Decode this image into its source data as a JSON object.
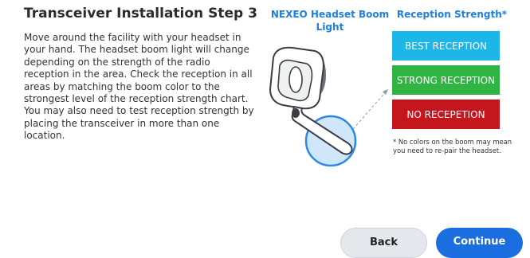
{
  "page": {
    "title": "Transceiver Installation Step 3",
    "instructions": "Move around the facility with your headset in your hand. The headset boom light will change depending on the strength of the radio reception in the area. Check the reception in all areas by matching the boom color to the strongest level of the reception strength chart. You may also need to test reception strength by placing the transceiver in more than one location."
  },
  "boom_light": {
    "heading": "NEXEO Headset Boom Light"
  },
  "reception": {
    "heading": "Reception Strength*",
    "levels": [
      {
        "label": "BEST RECEPTION",
        "color": "#1db6e9"
      },
      {
        "label": "STRONG RECEPTION",
        "color": "#30b444"
      },
      {
        "label": "NO RECEPETION",
        "color": "#c4161c"
      }
    ],
    "footnote": "* No colors on the boom may mean you need to re-pair the headset."
  },
  "buttons": {
    "back": "Back",
    "continue": "Continue"
  }
}
